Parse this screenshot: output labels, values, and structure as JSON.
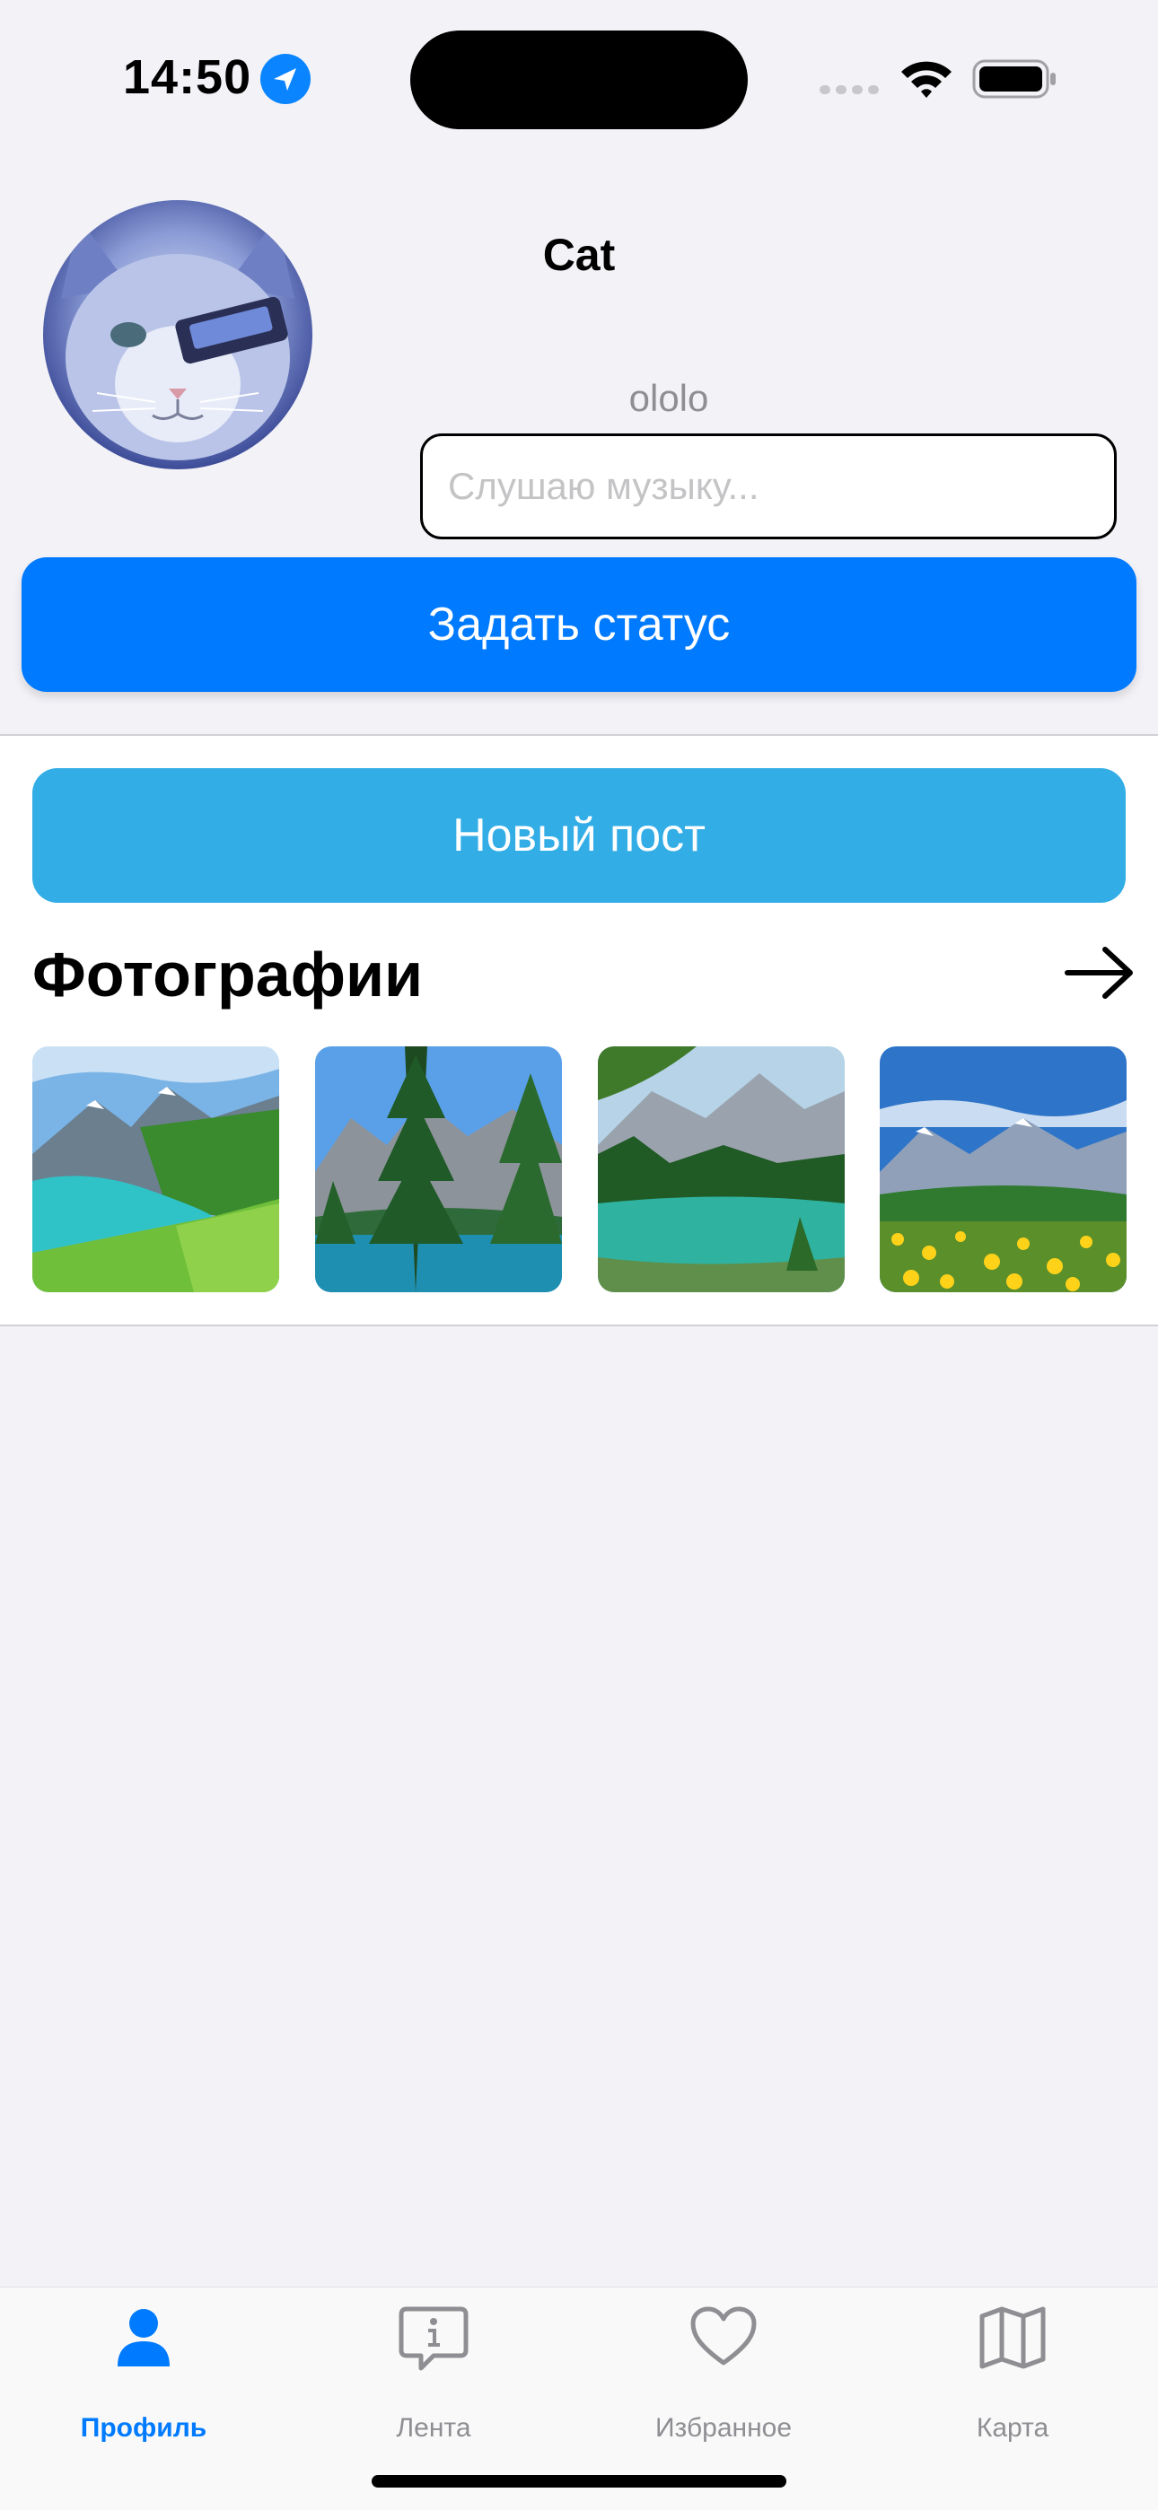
{
  "status_bar": {
    "time": "14:50",
    "icons": [
      "location-arrow-icon",
      "cellular-signal-icon",
      "wifi-icon",
      "battery-icon"
    ]
  },
  "profile": {
    "name": "Cat",
    "status": "ololo",
    "status_input_placeholder": "Слушаю музыку...",
    "status_input_value": "",
    "set_status_button": "Задать статус"
  },
  "feed": {
    "new_post_button": "Новый пост",
    "photos_title": "Фотографии",
    "photos": [
      {
        "name": "mountain-lake-photo"
      },
      {
        "name": "pine-lake-photo"
      },
      {
        "name": "alpine-river-photo"
      },
      {
        "name": "meadow-flowers-photo"
      }
    ]
  },
  "tab_bar": {
    "items": [
      {
        "label": "Профиль",
        "icon": "person-icon",
        "active": true
      },
      {
        "label": "Лента",
        "icon": "info-bubble-icon",
        "active": false
      },
      {
        "label": "Избранное",
        "icon": "heart-icon",
        "active": false
      },
      {
        "label": "Карта",
        "icon": "map-icon",
        "active": false
      }
    ]
  },
  "colors": {
    "accent": "#007aff",
    "new_post": "#32ade6",
    "background": "#f2f2f7",
    "inactive_tab": "#8e8e93"
  }
}
